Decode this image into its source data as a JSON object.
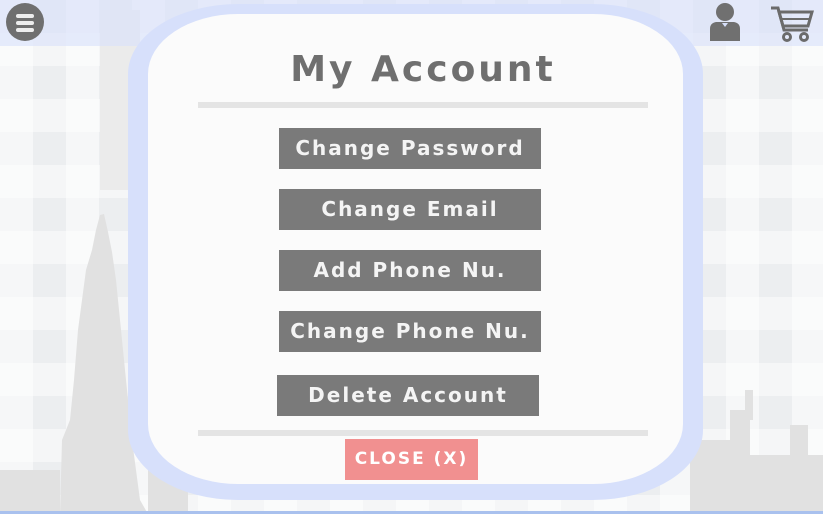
{
  "header": {
    "menu_icon": "hamburger-menu-icon",
    "user_icon": "user-profile-icon",
    "cart_icon": "shopping-cart-icon"
  },
  "modal": {
    "title": "My Account",
    "options": [
      {
        "label": "Change Password"
      },
      {
        "label": "Change Email"
      },
      {
        "label": "Add Phone Nu."
      },
      {
        "label": "Change Phone Nu."
      },
      {
        "label": "Delete Account"
      }
    ],
    "close_label": "CLOSE (X)"
  },
  "colors": {
    "button_bg": "#7a7a7a",
    "close_bg": "#f19090",
    "modal_border": "#d7e0fb",
    "title_text": "#6f6f6f"
  }
}
